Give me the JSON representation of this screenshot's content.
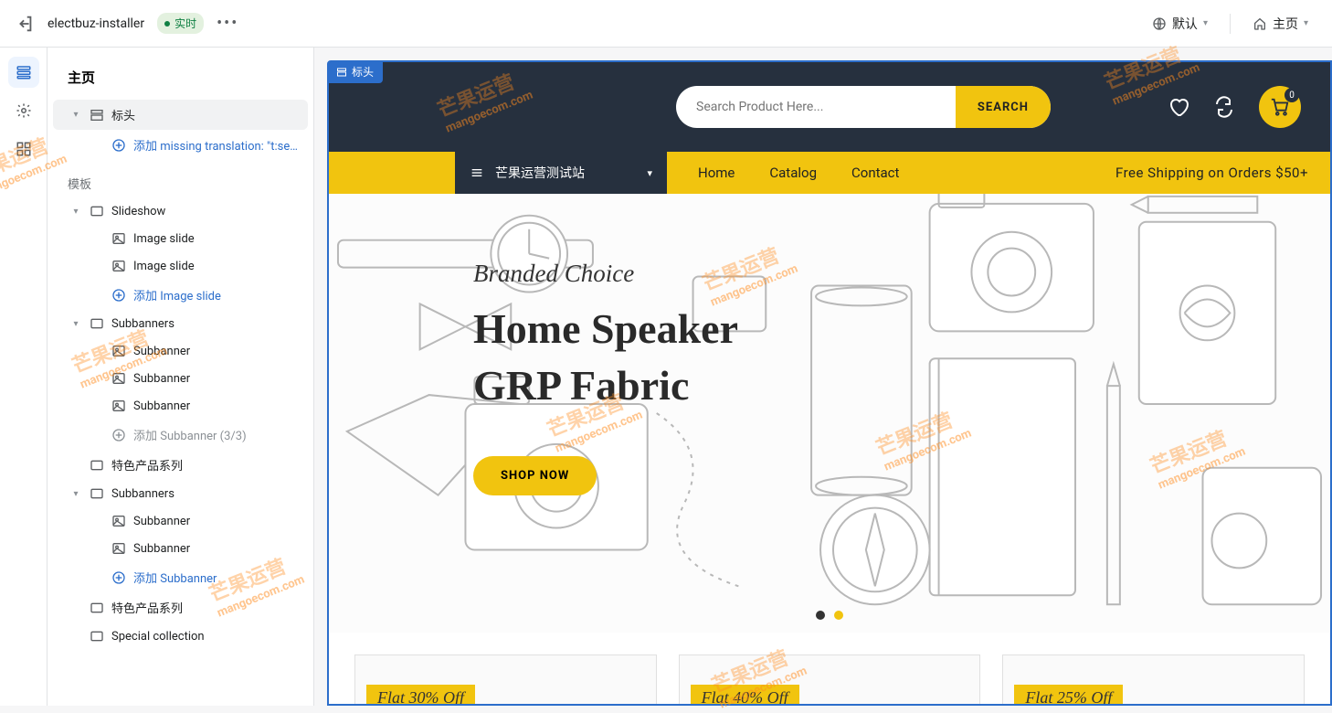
{
  "topbar": {
    "theme_name": "electbuz-installer",
    "status": "实时",
    "device_label": "默认",
    "page_label": "主页"
  },
  "sidebar": {
    "title": "主页",
    "header_section": "标头",
    "add_missing": "添加 missing translation: \"t:se...",
    "templates_label": "模板",
    "sections": {
      "slideshow": "Slideshow",
      "image_slide": "Image slide",
      "add_image_slide": "添加 Image slide",
      "subbanners": "Subbanners",
      "subbanner": "Subbanner",
      "add_subbanner_full": "添加 Subbanner (3/3)",
      "feature_collection": "特色产品系列",
      "add_subbanner": "添加 Subbanner",
      "special_collection": "Special collection"
    }
  },
  "frame_tag": "标头",
  "preview": {
    "search_placeholder": "Search Product Here...",
    "search_btn": "SEARCH",
    "cart_count": "0",
    "mega_label": "芒果运营测试站",
    "nav": {
      "home": "Home",
      "catalog": "Catalog",
      "contact": "Contact"
    },
    "promo": "Free Shipping on Orders $50+",
    "hero": {
      "subtitle": "Branded Choice",
      "title1": "Home Speaker",
      "title2": "GRP Fabric",
      "cta": "SHOP NOW"
    },
    "subbanners": {
      "b1": "Flat 30% Off",
      "b2": "Flat 40% Off",
      "b3": "Flat 25% Off"
    }
  },
  "watermark": {
    "cn": "芒果运营",
    "en": "mangoecom.com"
  }
}
